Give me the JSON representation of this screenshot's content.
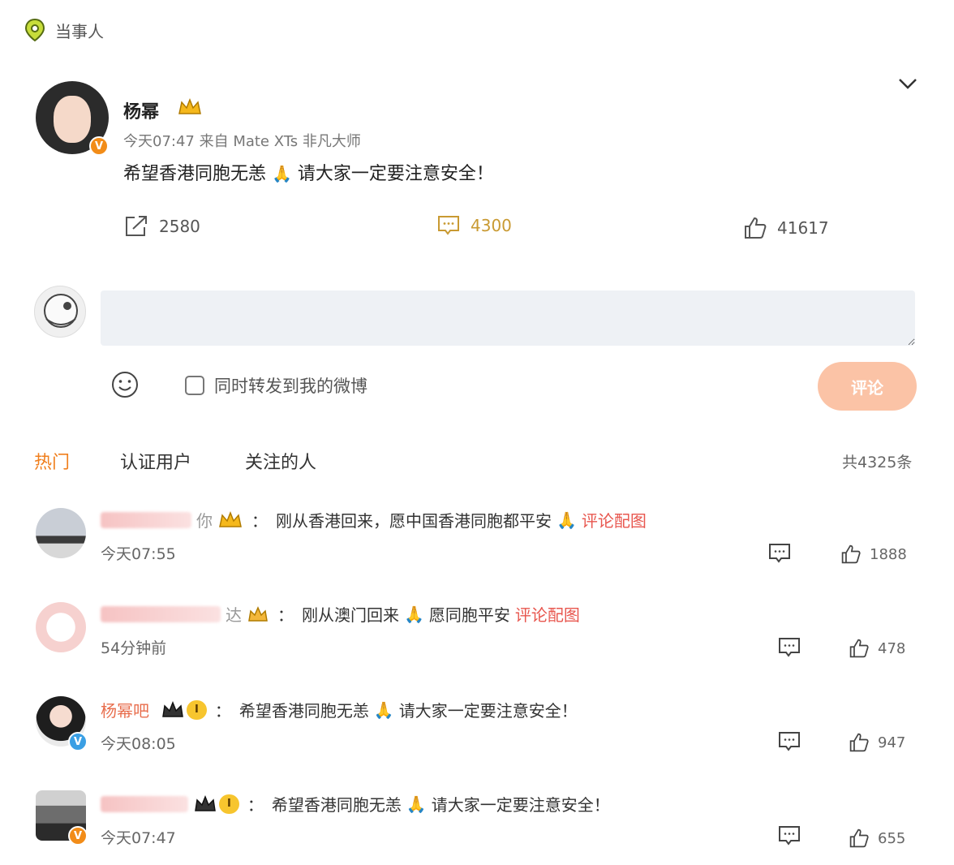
{
  "header": {
    "tag_label": "当事人"
  },
  "post": {
    "author": "杨幂",
    "meta": "今天07:47  来自 Mate XTs 非凡大师",
    "text_before": "希望香港同胞无恙",
    "emoji": "🙏",
    "text_after": "请大家一定要注意安全！",
    "repost_count": "2580",
    "comment_count": "4300",
    "like_count": "41617"
  },
  "composer": {
    "input_value": "",
    "forward_label": "同时转发到我的微博",
    "submit_label": "评论"
  },
  "tabs": {
    "hot": "热门",
    "verified": "认证用户",
    "following": "关注的人",
    "total": "共4325条"
  },
  "comments": [
    {
      "name_suffix": "你",
      "text": "刚从香港回来，愿中国香港同胞都平安",
      "emoji": "🙏",
      "pic_link": "评论配图",
      "time": "今天07:55",
      "likes": "1888"
    },
    {
      "name_suffix": "达",
      "text_before": "刚从澳门回来",
      "emoji": "🙏",
      "text_after": "愿同胞平安",
      "pic_link": "评论配图",
      "time": "54分钟前",
      "likes": "478"
    },
    {
      "name": "杨幂吧",
      "level": "I",
      "text_before": "希望香港同胞无恙",
      "emoji": "🙏",
      "text_after": "请大家一定要注意安全！",
      "time": "今天08:05",
      "likes": "947"
    },
    {
      "level": "I",
      "text_before": "希望香港同胞无恙",
      "emoji": "🙏",
      "text_after": "请大家一定要注意安全！",
      "time": "今天07:47",
      "likes": "655"
    }
  ],
  "colors": {
    "accent_orange": "#f07f1d",
    "comment_gold": "#c99a32",
    "submit_disabled": "#fbc3a6",
    "link_red": "#e8574f"
  }
}
